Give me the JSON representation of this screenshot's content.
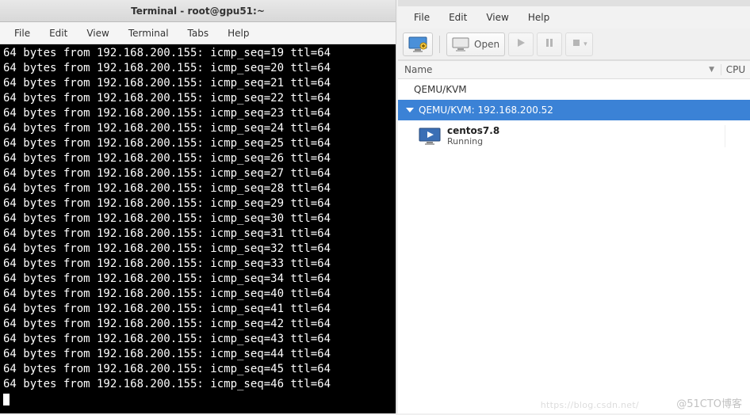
{
  "terminal": {
    "title": "Terminal - root@gpu51:~",
    "menu": [
      "File",
      "Edit",
      "View",
      "Terminal",
      "Tabs",
      "Help"
    ],
    "ping_src": "192.168.200.155",
    "line_prefix": "64 bytes from ",
    "ttl": 64,
    "seqs": [
      19,
      20,
      21,
      22,
      23,
      24,
      25,
      26,
      27,
      28,
      29,
      30,
      31,
      32,
      33,
      34,
      40,
      41,
      42,
      43,
      44,
      45,
      46
    ]
  },
  "vmm": {
    "menu": [
      "File",
      "Edit",
      "View",
      "Help"
    ],
    "toolbar": {
      "open_label": "Open"
    },
    "columns": {
      "name": "Name",
      "cpu": "CPU"
    },
    "groups": [
      {
        "label": "QEMU/KVM",
        "expanded": false,
        "selected": false
      },
      {
        "label": "QEMU/KVM: 192.168.200.52",
        "expanded": true,
        "selected": true
      }
    ],
    "vm": {
      "name": "centos7.8",
      "status": "Running"
    }
  },
  "watermarks": {
    "right": "@51CTO博客",
    "mid": "https://blog.csdn.net/"
  }
}
